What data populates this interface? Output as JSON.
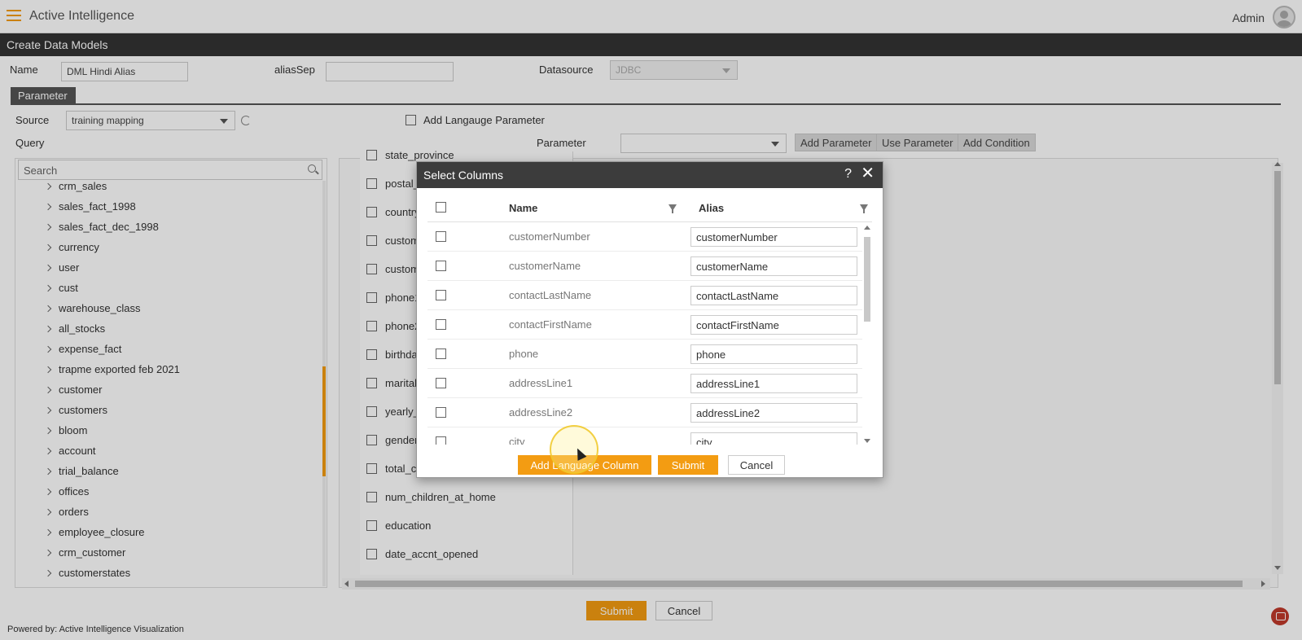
{
  "app": {
    "title": "Active Intelligence",
    "user": "Admin"
  },
  "subheader": {
    "title": "Create Data Models"
  },
  "form": {
    "name_label": "Name",
    "name_value": "DML Hindi Alias",
    "aliassep_label": "aliasSep",
    "aliassep_value": "",
    "datasource_label": "Datasource",
    "datasource_value": "JDBC",
    "parameter_tab": "Parameter",
    "source_label": "Source",
    "source_value": "training mapping",
    "add_language_param_label": "Add Langauge Parameter",
    "query_label": "Query",
    "parameter_label": "Parameter",
    "parameter_value": "",
    "add_parameter": "Add Parameter",
    "use_parameter": "Use Parameter",
    "add_condition": "Add Condition"
  },
  "tree": {
    "search_placeholder": "Search",
    "items": [
      "crm_sales",
      "sales_fact_1998",
      "sales_fact_dec_1998",
      "currency",
      "user",
      "cust",
      "warehouse_class",
      "all_stocks",
      "expense_fact",
      "trapme exported feb 2021",
      "customer",
      "customers",
      "bloom",
      "account",
      "trial_balance",
      "offices",
      "orders",
      "employee_closure",
      "crm_customer",
      "customerstates"
    ]
  },
  "columns_list": [
    "state_province",
    "postal_",
    "country",
    "custom",
    "custom",
    "phone1",
    "phone2",
    "birthda",
    "marital",
    "yearly_",
    "gender",
    "total_c",
    "num_children_at_home",
    "education",
    "date_accnt_opened"
  ],
  "main_buttons": {
    "submit": "Submit",
    "cancel": "Cancel"
  },
  "footer": {
    "text": "Powered by: Active Intelligence Visualization"
  },
  "modal": {
    "title": "Select Columns",
    "help": "?",
    "close": "✕",
    "header_name": "Name",
    "header_alias": "Alias",
    "rows": [
      {
        "name": "customerNumber",
        "alias": "customerNumber"
      },
      {
        "name": "customerName",
        "alias": "customerName"
      },
      {
        "name": "contactLastName",
        "alias": "contactLastName"
      },
      {
        "name": "contactFirstName",
        "alias": "contactFirstName"
      },
      {
        "name": "phone",
        "alias": "phone"
      },
      {
        "name": "addressLine1",
        "alias": "addressLine1"
      },
      {
        "name": "addressLine2",
        "alias": "addressLine2"
      },
      {
        "name": "city",
        "alias": "city"
      }
    ],
    "add_language_column": "Add Language Column",
    "submit": "Submit",
    "cancel": "Cancel"
  },
  "colors": {
    "accent": "#f39c12",
    "header_dark": "#333333",
    "modal_header": "#3c3c3c"
  }
}
